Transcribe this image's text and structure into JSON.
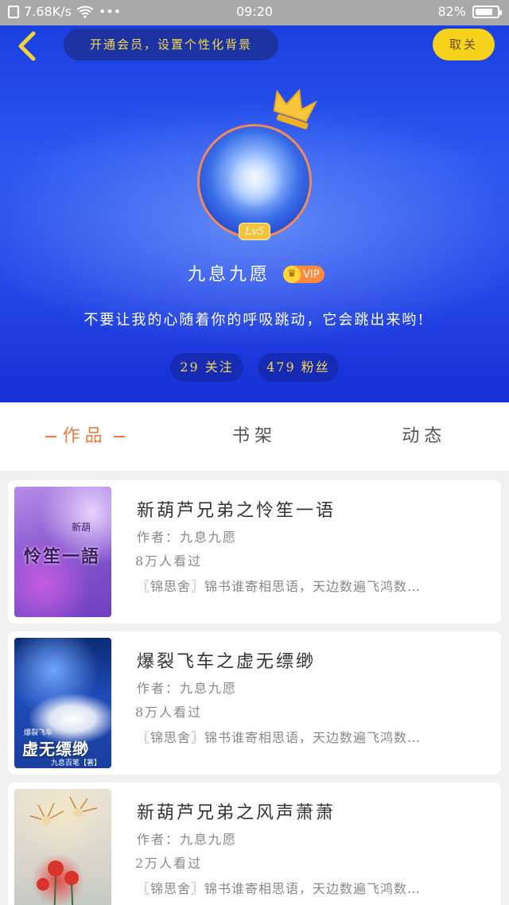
{
  "status_bar": {
    "speed": "7.68K/s",
    "more": "•••",
    "time": "09:20",
    "battery": "82%",
    "battery_level": 0.82
  },
  "header": {
    "vip_banner": "开通会员，设置个性化背景",
    "close_label": "取关",
    "level": "Lv5",
    "username": "九息九愿",
    "vip_label": "VIP",
    "bio": "不要让我的心随着你的呼吸跳动，它会跳出来哟!",
    "stats": {
      "follow": "29 关注",
      "fans": "479 粉丝"
    }
  },
  "tabs": [
    {
      "label": "作品",
      "active": true
    },
    {
      "label": "书架",
      "active": false
    },
    {
      "label": "动态",
      "active": false
    }
  ],
  "books": [
    {
      "title": "新葫芦兄弟之怜笙一语",
      "author": "作者：九息九愿",
      "readers": "8万人看过",
      "desc": "〖锦思舍〗锦书谁寄相思语，天边数遍飞鸿数…",
      "cover_title": "怜笙一語",
      "cover_sub": "新葫"
    },
    {
      "title": "爆裂飞车之虚无缥缈",
      "author": "作者：九息九愿",
      "readers": "8万人看过",
      "desc": "〖锦思舍〗锦书谁寄相思语，天边数遍飞鸿数…",
      "cover_title": "虚无缥缈",
      "cover_tag": "爆裂飞车",
      "cover_author": "九息百笔【著】"
    },
    {
      "title": "新葫芦兄弟之风声萧萧",
      "author": "作者：九息九愿",
      "readers": "2万人看过",
      "desc": "〖锦思舍〗锦书谁寄相思语，天边数遍飞鸿数…"
    }
  ]
}
